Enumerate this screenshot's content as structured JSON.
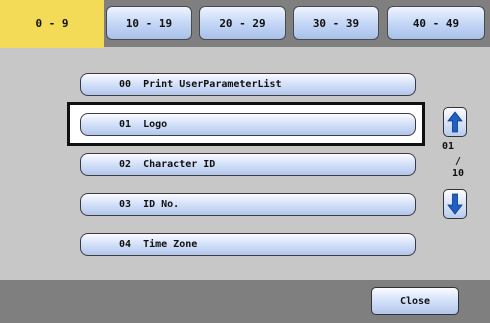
{
  "tabs": [
    {
      "label": "0 - 9",
      "active": true
    },
    {
      "label": "10 - 19",
      "active": false
    },
    {
      "label": "20 - 29",
      "active": false
    },
    {
      "label": "30 - 39",
      "active": false
    },
    {
      "label": "40 - 49",
      "active": false
    }
  ],
  "list": {
    "items": [
      {
        "label": "00  Print UserParameterList"
      },
      {
        "label": "01  Logo",
        "selected": true
      },
      {
        "label": "02  Character ID"
      },
      {
        "label": "03  ID No."
      },
      {
        "label": "04  Time Zone"
      }
    ]
  },
  "pager": {
    "current": "01",
    "separator": "/",
    "total": "10",
    "up_icon": "arrow-up-icon",
    "down_icon": "arrow-down-icon"
  },
  "footer": {
    "close_label": "Close"
  },
  "colors": {
    "active_tab": "#f3da57",
    "frame_background": "#7f7f7f",
    "panel_background": "#c7c7c7",
    "arrow_blue": "#1f5fc6"
  }
}
